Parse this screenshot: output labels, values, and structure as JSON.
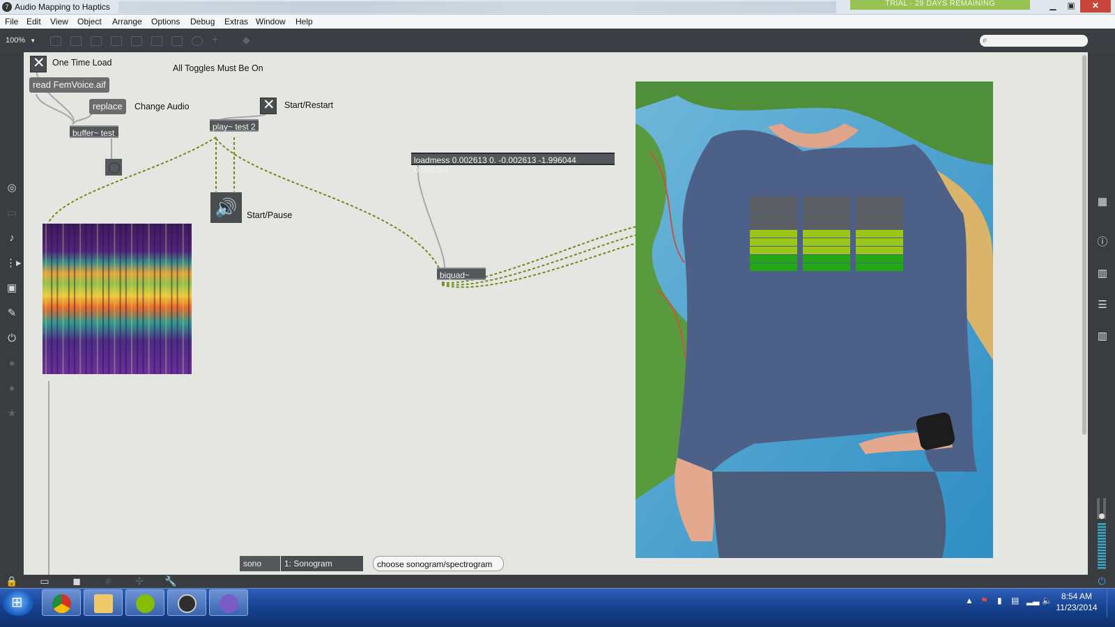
{
  "window": {
    "title": "Audio Mapping to Haptics",
    "trial_banner": "TRIAL - 29 DAYS REMAINING",
    "controls": {
      "minimize": "▁",
      "maximize": "▣",
      "close": "✕"
    }
  },
  "menubar": {
    "items": [
      "File",
      "Edit",
      "View",
      "Object",
      "Arrange",
      "Options",
      "Debug",
      "Extras",
      "Window",
      "Help"
    ]
  },
  "toolbar": {
    "zoom": "100%",
    "zoom_arrow": "▼",
    "icons": [
      "new-object-icon",
      "message-icon",
      "comment-icon",
      "toggle-icon",
      "button-icon",
      "inlet-icon",
      "outlet-icon",
      "number-icon",
      "add-icon",
      "paint-bucket-icon"
    ],
    "search_placeholder": ""
  },
  "patcher": {
    "labels": {
      "one_time_load": "One Time Load",
      "all_toggles": "All Toggles Must Be On",
      "change_audio": "Change Audio",
      "start_restart": "Start/Restart",
      "start_pause": "Start/Pause"
    },
    "messages": {
      "read": "read FemVoice.aif",
      "replace": "replace",
      "loadmess": "loadmess 0.002613 0. -0.002613 -1.996044 0.996091"
    },
    "objects": {
      "buffer": "buffer~ test",
      "play": "play~ test 2",
      "biquad": "biquad~"
    },
    "toggle_mark": "✕",
    "speaker_glyph": "🔊",
    "bottom_widgets": {
      "sono": "sono",
      "mode": "1: Sonogram",
      "choose": "choose sonogram/spectrogram"
    }
  },
  "shirt_meter": {
    "columns": 3,
    "segments_per_column": 9,
    "lit_segments": 5,
    "colors": {
      "off": "#5c5f62",
      "yellow_green": "#9cc51a",
      "green": "#22a814"
    }
  },
  "bottombar": {
    "icons": [
      "lock-icon",
      "presentation-icon",
      "comment-bubble-icon",
      "grid-icon",
      "snap-icon",
      "wrench-icon"
    ]
  },
  "taskbar": {
    "apps": [
      "chrome-icon",
      "explorer-icon",
      "spotify-icon",
      "max-icon",
      "cycling74-icon"
    ],
    "clock_time": "8:54 AM",
    "clock_date": "11/23/2014"
  },
  "colors": {
    "canvas": "#e5e5e1",
    "patchcord_signal": "#6f8a18",
    "patchcord_control": "#a7a7a7"
  }
}
